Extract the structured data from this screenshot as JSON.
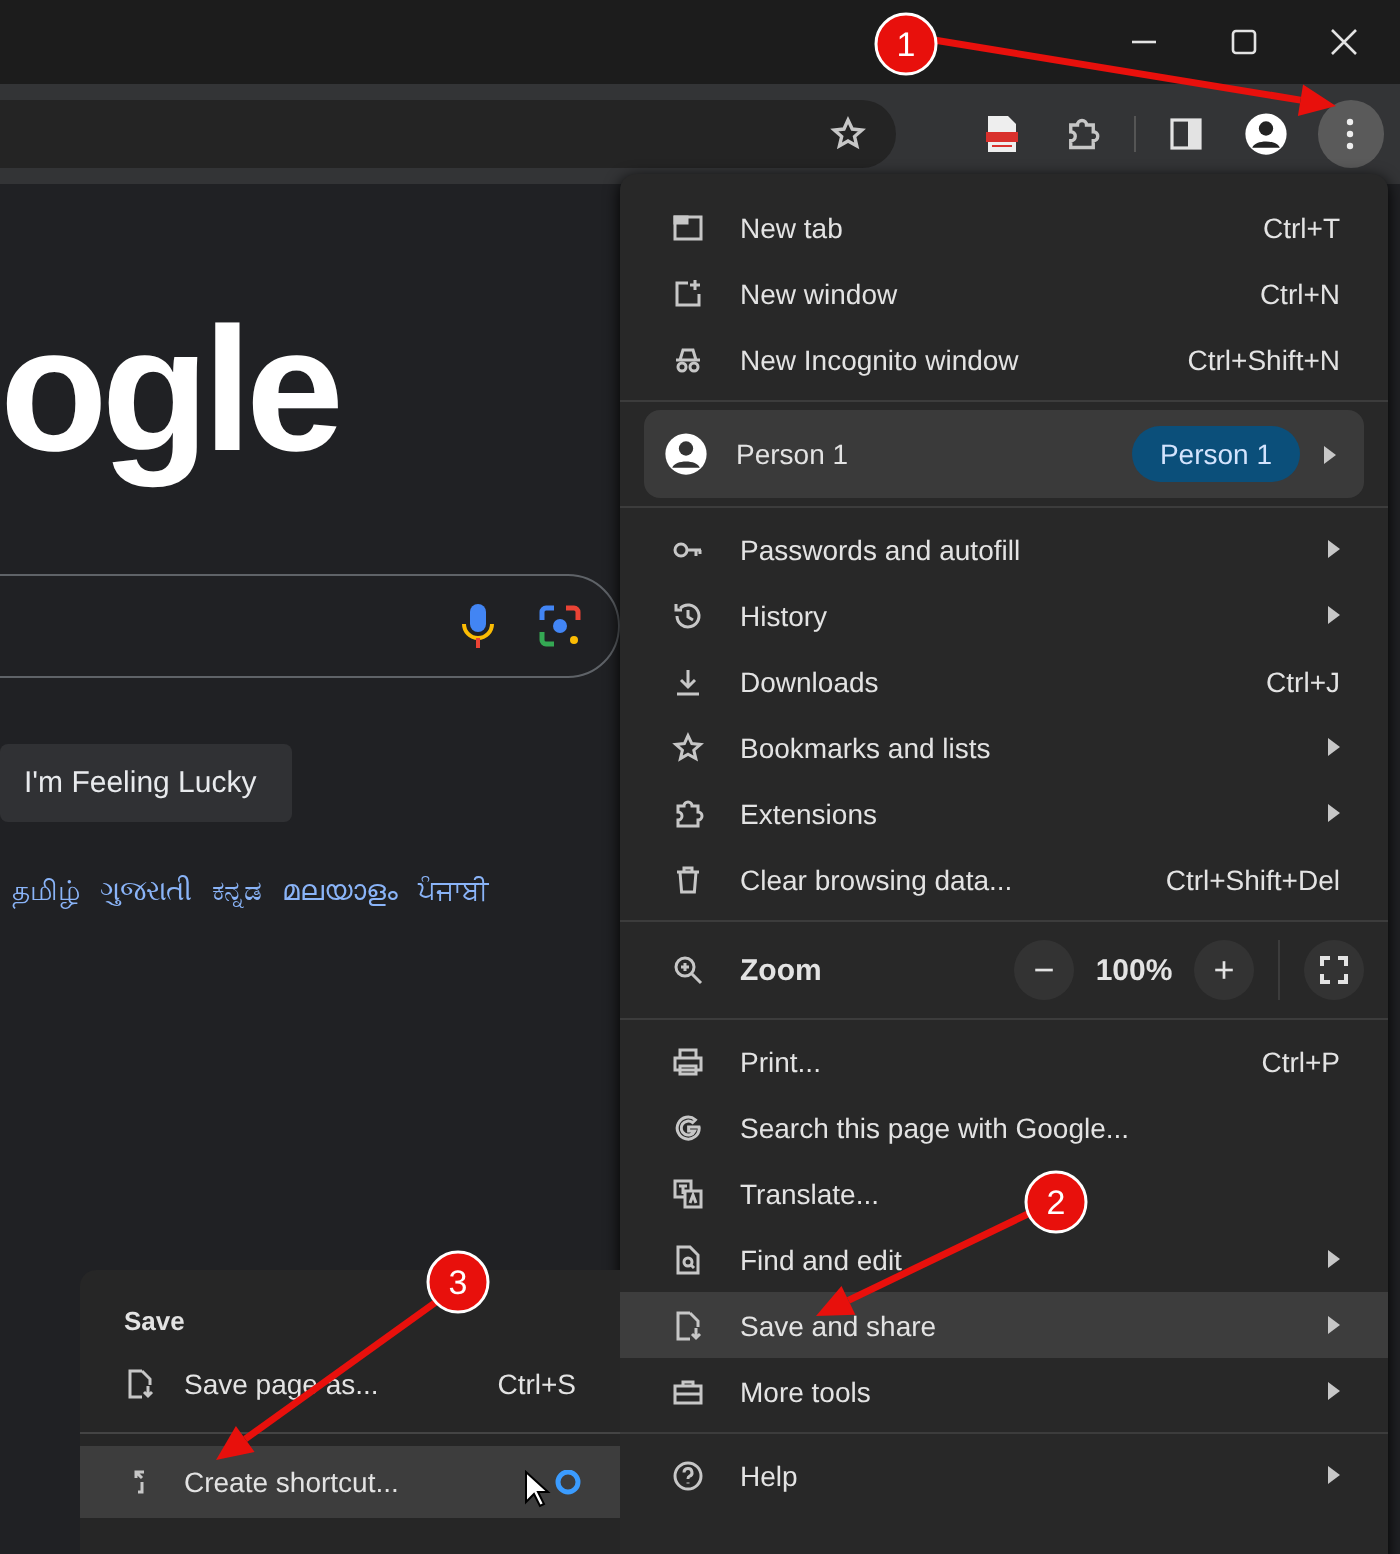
{
  "page": {
    "logo_text": "ogle",
    "lucky_button": "I'm Feeling Lucky",
    "languages": [
      "தமிழ்",
      "ગુજરાતી",
      "ಕನ್ನಡ",
      "മലയാളം",
      "ਪੰਜਾਬੀ"
    ]
  },
  "menu": {
    "sections": [
      {
        "kind": "items",
        "items": [
          {
            "label": "New tab",
            "shortcut": "Ctrl+T",
            "submenu": false,
            "selected": false
          },
          {
            "label": "New window",
            "shortcut": "Ctrl+N",
            "submenu": false,
            "selected": false
          },
          {
            "label": "New Incognito window",
            "shortcut": "Ctrl+Shift+N",
            "submenu": false,
            "selected": false
          }
        ]
      },
      {
        "kind": "profile",
        "name": "Person 1",
        "badge": "Person 1"
      },
      {
        "kind": "items",
        "items": [
          {
            "label": "Passwords and autofill",
            "submenu": true,
            "selected": false
          },
          {
            "label": "History",
            "submenu": true,
            "selected": false
          },
          {
            "label": "Downloads",
            "shortcut": "Ctrl+J",
            "submenu": false,
            "selected": false
          },
          {
            "label": "Bookmarks and lists",
            "submenu": true,
            "selected": false
          },
          {
            "label": "Extensions",
            "submenu": true,
            "selected": false
          },
          {
            "label": "Clear browsing data...",
            "shortcut": "Ctrl+Shift+Del",
            "submenu": false,
            "selected": false
          }
        ]
      },
      {
        "kind": "zoom",
        "label": "Zoom",
        "minus": "−",
        "level": "100%",
        "plus": "+"
      },
      {
        "kind": "items",
        "items": [
          {
            "label": "Print...",
            "shortcut": "Ctrl+P",
            "submenu": false,
            "selected": false
          },
          {
            "label": "Search this page with Google...",
            "submenu": false,
            "selected": false
          },
          {
            "label": "Translate...",
            "submenu": false,
            "selected": false
          },
          {
            "label": "Find and edit",
            "submenu": true,
            "selected": false
          },
          {
            "label": "Save and share",
            "submenu": true,
            "selected": true
          },
          {
            "label": "More tools",
            "submenu": true,
            "selected": false
          }
        ]
      },
      {
        "kind": "items",
        "items": [
          {
            "label": "Help",
            "submenu": true,
            "selected": false
          }
        ]
      }
    ]
  },
  "submenu": {
    "title": "Save",
    "items": [
      {
        "label": "Save page as...",
        "shortcut": "Ctrl+S",
        "selected": false
      },
      {
        "label": "Create shortcut...",
        "selected": true
      }
    ]
  },
  "annotations": [
    {
      "label": "1"
    },
    {
      "label": "2"
    },
    {
      "label": "3"
    }
  ]
}
